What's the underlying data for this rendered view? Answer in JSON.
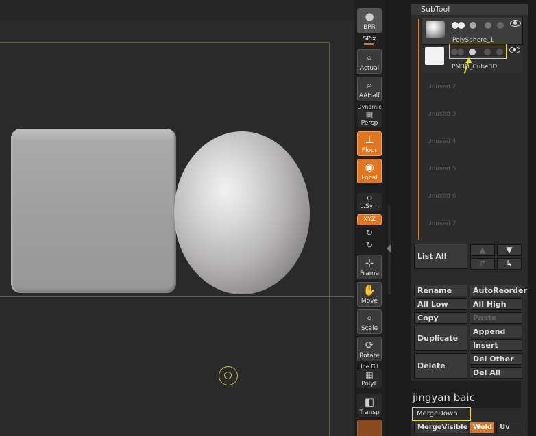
{
  "shelf": {
    "bpr": "BPR",
    "spix": "SPix",
    "actual": "Actual",
    "aahalf": "AAHalf",
    "dynamic": "Dynamic",
    "persp": "Persp",
    "floor": "Floor",
    "local": "Local",
    "lsym": "L.Sym",
    "xyz": "XYZ",
    "frame": "Frame",
    "move": "Move",
    "scale": "Scale",
    "rotate": "Rotate",
    "linefill": "Ine Fill",
    "polyf": "PolyF",
    "transp": "Transp"
  },
  "subtool": {
    "title": "SubTool",
    "items": [
      {
        "name": "PolySphere_1"
      },
      {
        "name": "PM3D_Cube3D"
      }
    ],
    "unused": [
      "Unused 2",
      "Unused 3",
      "Unused 4",
      "Unused 5",
      "Unused 6",
      "Unused 7"
    ],
    "list_all": "List All",
    "buttons": {
      "rename": "Rename",
      "autoreorder": "AutoReorder",
      "all_low": "All Low",
      "all_high": "All High",
      "copy": "Copy",
      "paste": "Paste",
      "duplicate": "Duplicate",
      "append": "Append",
      "insert": "Insert",
      "delete": "Delete",
      "del_other": "Del Other",
      "del_all": "Del All",
      "merge_down": "MergeDown",
      "merge_visible": "MergeVisible",
      "weld": "Weld",
      "uv": "Uv"
    },
    "watermark": "jingyan baic"
  },
  "colors": {
    "accent": "#e2761e",
    "highlight": "#e8e01a"
  }
}
